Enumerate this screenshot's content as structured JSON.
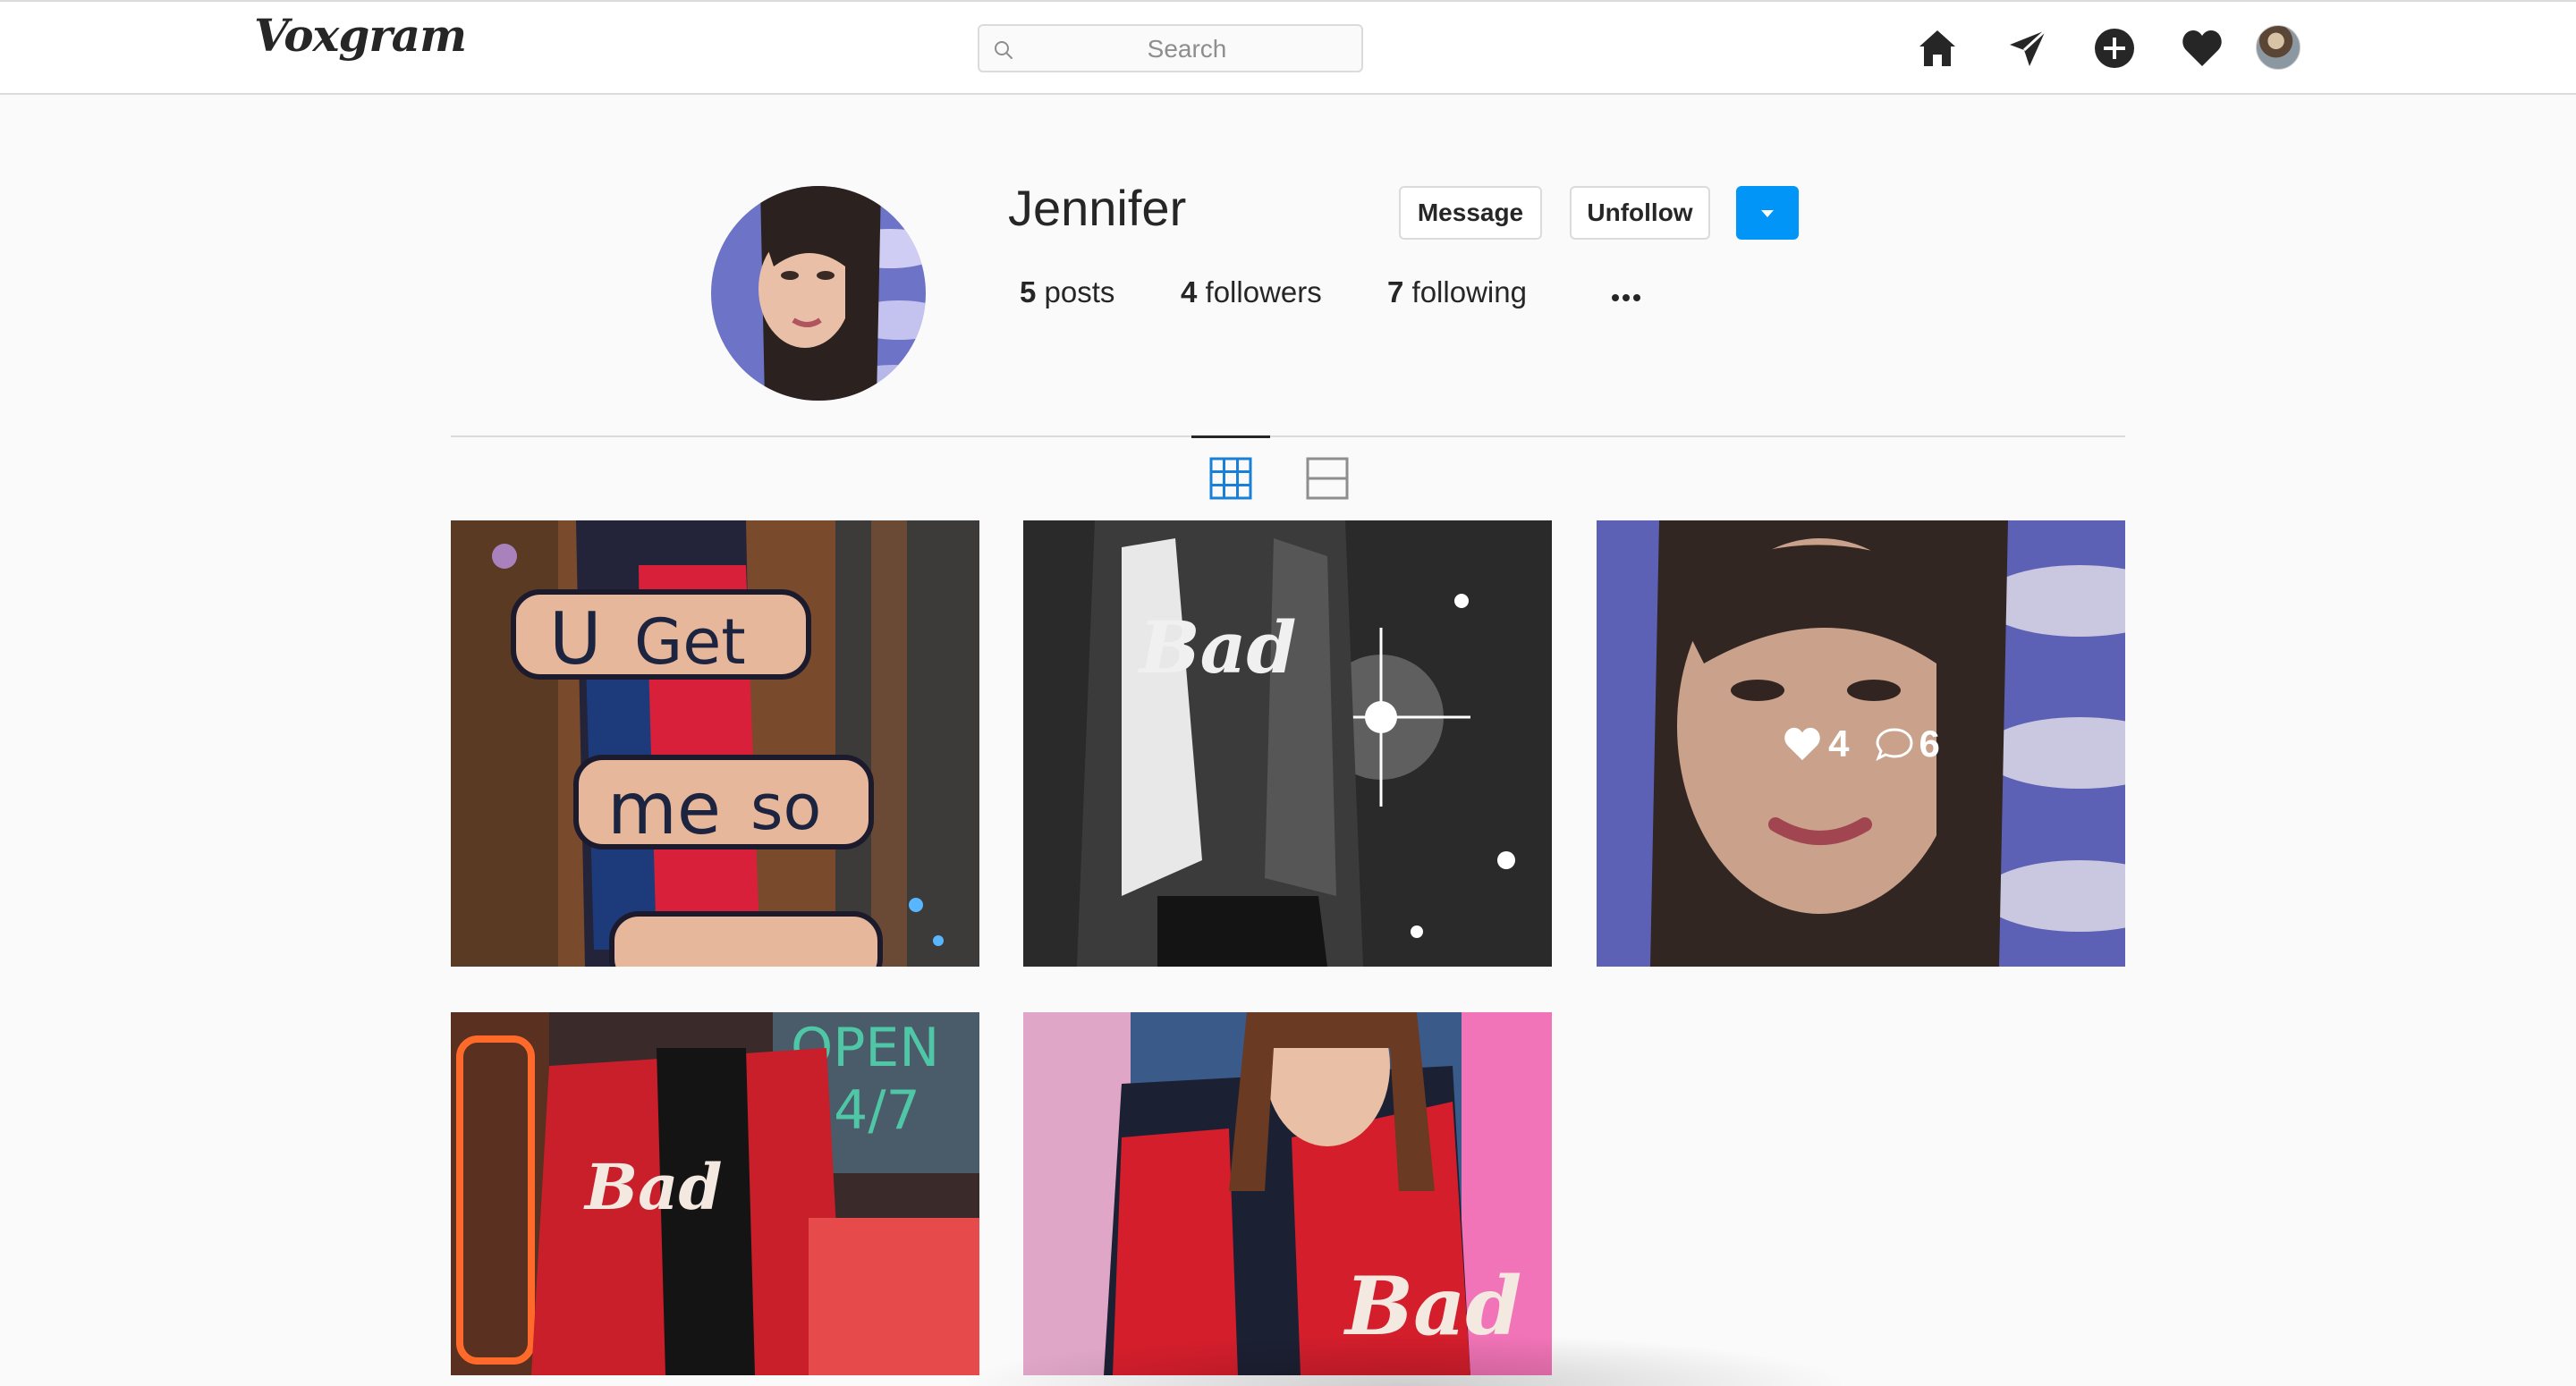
{
  "app": {
    "logo_text": "Voxgram"
  },
  "search": {
    "placeholder": "Search",
    "value": ""
  },
  "nav": {
    "icons": [
      "home-icon",
      "direct-send-icon",
      "new-post-icon",
      "activity-heart-icon",
      "profile-avatar"
    ]
  },
  "profile": {
    "username": "Jennifer",
    "message_label": "Message",
    "unfollow_label": "Unfollow",
    "stats": {
      "posts_count": "5",
      "posts_label": "posts",
      "followers_count": "4",
      "followers_label": "followers",
      "following_count": "7",
      "following_label": "following"
    }
  },
  "tabs": {
    "active": "grid",
    "items": [
      "grid-view",
      "feed-view"
    ]
  },
  "posts": [
    {
      "id": "post-1",
      "likes": "",
      "comments": ""
    },
    {
      "id": "post-2",
      "likes": "",
      "comments": ""
    },
    {
      "id": "post-3",
      "likes": "4",
      "comments": "6",
      "hovered": true
    },
    {
      "id": "post-4",
      "likes": "",
      "comments": ""
    },
    {
      "id": "post-5",
      "likes": "",
      "comments": ""
    }
  ],
  "colors": {
    "accent": "#0095f6",
    "grid_tab_active": "#1a7fd6",
    "border": "#dbdbdb",
    "text": "#262626",
    "background": "#fafafa"
  }
}
